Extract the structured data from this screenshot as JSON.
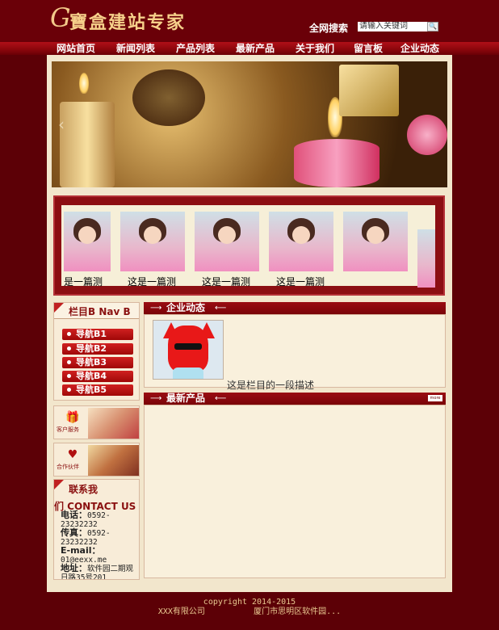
{
  "header": {
    "logo_g": "G",
    "logo_text": "寶盒建站专家",
    "search_label": "全网搜索",
    "search_placeholder": "请输入关键词",
    "search_button": "🔍"
  },
  "nav": {
    "items": [
      {
        "label": "网站首页"
      },
      {
        "label": "新闻列表"
      },
      {
        "label": "产品列表"
      },
      {
        "label": "最新产品"
      },
      {
        "label": "关于我们"
      },
      {
        "label": "留言板"
      },
      {
        "label": "企业动态"
      }
    ]
  },
  "banner": {
    "prev_arrow": "‹"
  },
  "gallery": {
    "items": [
      {
        "caption": "是一篇测"
      },
      {
        "caption": "这是一篇测"
      },
      {
        "caption": "这是一篇测"
      },
      {
        "caption": "这是一篇测"
      },
      {
        "caption": ""
      }
    ]
  },
  "sidebar": {
    "title": "栏目B  Nav B",
    "items": [
      {
        "label": "导航B1"
      },
      {
        "label": "导航B2"
      },
      {
        "label": "导航B3"
      },
      {
        "label": "导航B4"
      },
      {
        "label": "导航B5"
      }
    ],
    "ads": [
      {
        "label": "客户服务",
        "icon": "gift-icon",
        "glyph": "🎁"
      },
      {
        "label": "合作伙伴",
        "icon": "heart-icon",
        "glyph": "♥"
      }
    ]
  },
  "contact": {
    "title": "联系我",
    "title_en": "们 CONTACT US",
    "phone_label": "电话：",
    "phone_value": "0592-23232232",
    "fax_label": "传真：",
    "fax_value": "0592-23232232",
    "email_label": "E-mail：",
    "email_value": "01@eexx.me",
    "address_label": "地址：",
    "address_value": "软件园二期观日路35号201"
  },
  "sections": {
    "news": {
      "title": "企业动态",
      "arrow_left": "⟶",
      "arrow_right": "⟵",
      "desc": "这是栏目的一段描述"
    },
    "products": {
      "title": "最新产品",
      "arrow_left": "⟶",
      "arrow_right": "⟵",
      "more": "more"
    }
  },
  "footer": {
    "copyright": "copyright 2014-2015",
    "company": "XXX有限公司",
    "address": "厦门市思明区软件园..."
  },
  "colors": {
    "background": "#5c0006",
    "panel": "#f2e6cc",
    "accent": "#9a0c12"
  }
}
